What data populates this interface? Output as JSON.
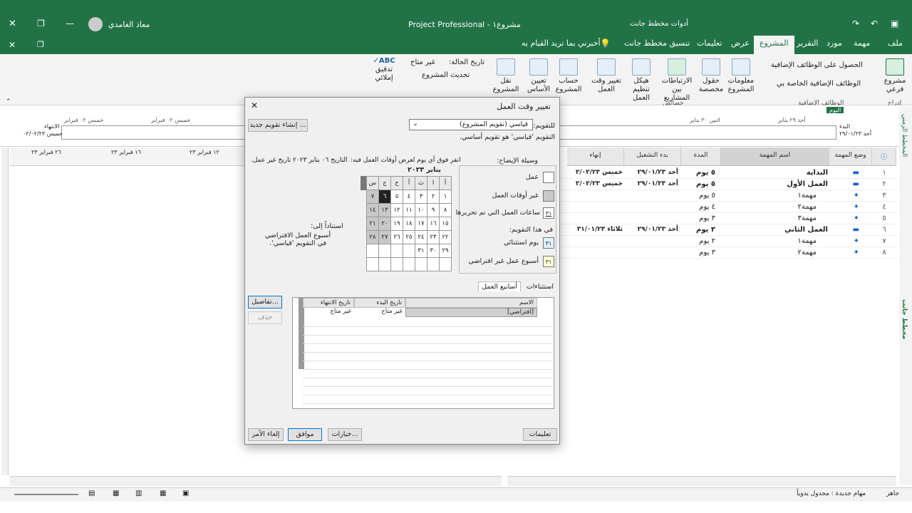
{
  "titlebar": {
    "title": "مشروع١  -  Project Professional",
    "tools": "أدوات مخطط جانت",
    "user": "معاذ الغامدي"
  },
  "tabs": [
    "ملف",
    "مهمة",
    "مورد",
    "التقرير",
    "المشروع",
    "عرض",
    "تعليمات",
    "تنسيق مخطط جانت"
  ],
  "tell_me": "أخبرني بما تريد القيام به",
  "ribbon": {
    "subproject": "مشروع فرعي",
    "insert_group": "إدراج",
    "get_addins": "الحصول على الوظائف الإضافية",
    "my_addins": "الوظائف الإضافية الخاصة بي",
    "addins_group": "الوظائف الإضافية",
    "project_info": "معلومات المشروع",
    "custom_fields": "حقول مخصصة",
    "links": "الارتباطات بين المشاريع",
    "wbs": "هيكل تنظيم العمل",
    "change_time": "تغيير وقت العمل",
    "properties_group": "خصائص",
    "calc_project": "حساب المشروع",
    "baseline": "تعيين الأساس",
    "move_project": "نقل المشروع",
    "status_date_label": "تاريخ الحالة:",
    "status_date": "غير متاح",
    "update_project": "تحديث المشروع",
    "spelling": "تدقيق إملائي"
  },
  "timeline": {
    "today": "اليوم",
    "start_label": "البدء",
    "start_date": "أحد ٢٩/٠١/٢٣",
    "finish_label": "الانتهاء",
    "finish_date": "خميس ٠٢/٠٢/٢٣",
    "ticks": [
      "أحد ٢٩ يناير",
      "اثنين ٣٠ يناير",
      "خميس ٠٢ فبراير",
      "خميس ٠٢ فبراير"
    ]
  },
  "gantt_header": [
    "٢٦ فبراير ٢٣",
    "١٦ فبراير ٢٣",
    "١٢ فبراير ٢٣",
    "٢٣ فبراير"
  ],
  "table": {
    "headers": [
      "وضع المهمة",
      "اسم المهمة",
      "المدة",
      "بدء التشغيل",
      "إنهاء"
    ],
    "rows": [
      {
        "id": "١",
        "name": "البداية",
        "dur": "٥ يوم",
        "start": "أحد ٢٩/٠١/٢٣",
        "finish": "خميس ٢/٠٢/٢٣"
      },
      {
        "id": "٢",
        "name": "العمل الأول",
        "dur": "٥ يوم",
        "start": "أحد ٢٩/٠١/٢٣",
        "finish": "خميس ٢/٠٢/٢٣"
      },
      {
        "id": "٣",
        "name": "مهمة١",
        "dur": "٥ يوم",
        "start": "",
        "finish": ""
      },
      {
        "id": "٤",
        "name": "مهمة٢",
        "dur": "٤ يوم",
        "start": "",
        "finish": ""
      },
      {
        "id": "٥",
        "name": "مهمة٣",
        "dur": "٣ يوم",
        "start": "",
        "finish": ""
      },
      {
        "id": "٦",
        "name": "العمل الثاني",
        "dur": "٣ يوم",
        "start": "أحد ٢٩/٠١/٢٣",
        "finish": "ثلاثاء ٣١/٠١/٢٣"
      },
      {
        "id": "٧",
        "name": "مهمة١",
        "dur": "٢ يوم",
        "start": "",
        "finish": ""
      },
      {
        "id": "٨",
        "name": "مهمة٢",
        "dur": "٣ يوم",
        "start": "",
        "finish": ""
      }
    ]
  },
  "dialog": {
    "title": "تغيير وقت العمل",
    "calendar_label": "للتقويم:",
    "calendar_value": "قياسي (تقويم المشروع)",
    "calendar_note": "التقويم 'قياسي' هو تقويم أساسي.",
    "new_calendar": "إنشاء تقويم جديد ...",
    "legend_title": "وسيلة الإيضاح:",
    "legend_work": "عمل",
    "legend_nonwork": "غير أوقات العمل",
    "legend_edited": "ساعات العمل التي تم تحريرها",
    "legend_on_this": "في هذا التقويم:",
    "legend_exception": "يوم استثنائي",
    "legend_nondefault": "أسبوع عمل غير افتراضي",
    "click_day": "انقر فوق أي يوم لعرض أوقات العمل فيه:",
    "month": "يناير ٢٠٢٣",
    "weekdays": [
      "أ",
      "ا",
      "ث",
      "أ",
      "خ",
      "ج",
      "س"
    ],
    "weeks": [
      [
        "١",
        "٢",
        "٣",
        "٤",
        "٥",
        "٦",
        "٧"
      ],
      [
        "٨",
        "٩",
        "١٠",
        "١١",
        "١٢",
        "١٣",
        "١٤"
      ],
      [
        "١٥",
        "١٦",
        "١٧",
        "١٨",
        "١٩",
        "٢٠",
        "٢١"
      ],
      [
        "٢٢",
        "٢٣",
        "٢٤",
        "٢٥",
        "٢٦",
        "٢٧",
        "٢٨"
      ],
      [
        "٢٩",
        "٣٠",
        "٣١",
        "",
        "",
        "",
        ""
      ],
      [
        "",
        "",
        "",
        "",
        "",
        "",
        ""
      ]
    ],
    "date_info": "التاريخ ٠٦ يناير ٢٠٢٣ تاريخ غير عمل.",
    "based_on": "استناداً إلى:",
    "based_on_detail": "أسبوع العمل الافتراضي في التقويم 'قياسي'.",
    "tab_exceptions": "استثناءات",
    "tab_workweeks": "أسابيع العمل",
    "grid_headers": [
      "الاسم",
      "تاريخ البدء",
      "تاريخ الانتهاء"
    ],
    "grid_row": {
      "name": "[افتراضي]",
      "start": "غير متاح",
      "finish": "غير متاح"
    },
    "details": "تفاصيل...",
    "delete": "حذف",
    "help": "تعليمات",
    "options": "خيارات...",
    "ok": "موافق",
    "cancel": "إلغاء الأمر"
  },
  "status": {
    "ready": "جاهز",
    "new_tasks": "مهام جديدة : مجدول يدوياً"
  },
  "vertical_labels": {
    "timeline": "المخطط الزمني",
    "gantt": "مخطط جانت"
  }
}
